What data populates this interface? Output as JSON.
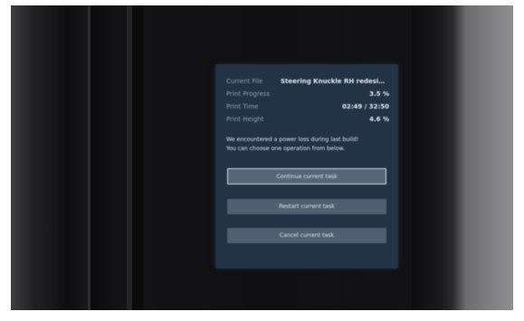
{
  "status": {
    "current_file_label": "Current File",
    "current_file_value": "Steering Knuckle RH redesig...",
    "print_progress_label": "Print Progress",
    "print_progress_value": "3.5 %",
    "print_time_label": "Print Time",
    "print_time_value": "02:49 / 32:50",
    "print_height_label": "Print Height",
    "print_height_value": "4.6 %"
  },
  "message": {
    "line1": "We encountered a power loss during last build!",
    "line2": "You can choose one operation from below."
  },
  "actions": {
    "continue_label": "Continue current task",
    "restart_label": "Restart current task",
    "cancel_label": "Cancel current task"
  },
  "colors": {
    "screen_bg": "#233346",
    "button_bg": "#50606f",
    "text_light": "#e4ebf3"
  }
}
